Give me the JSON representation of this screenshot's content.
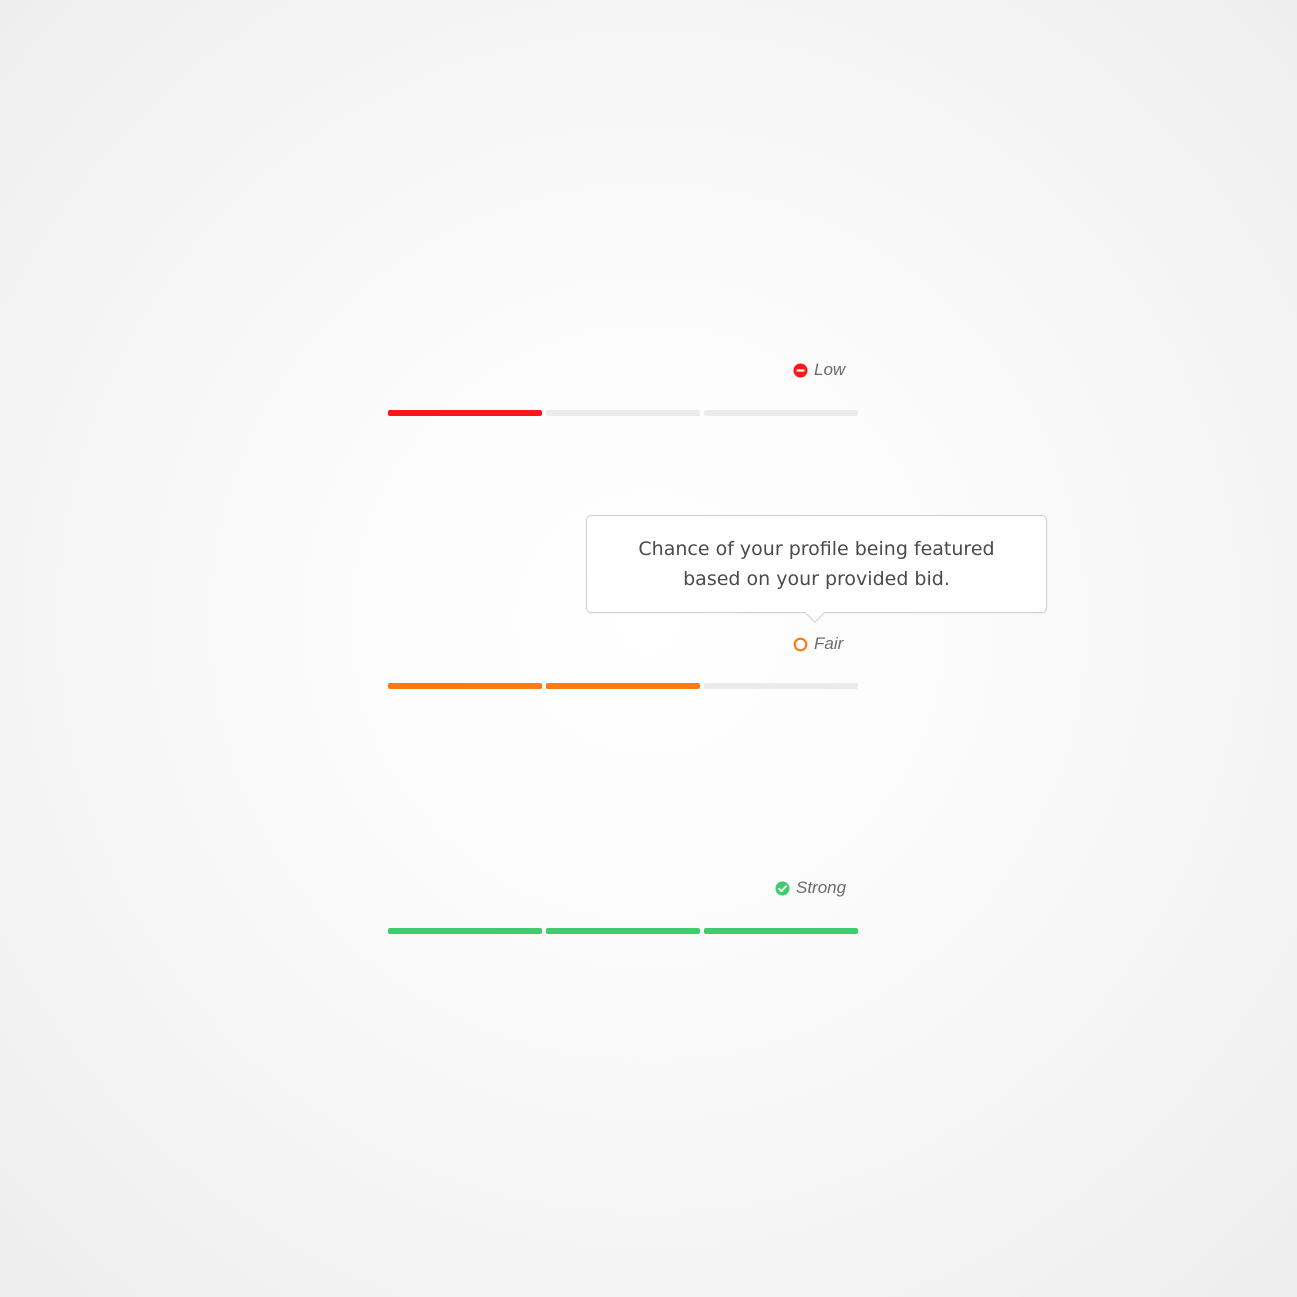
{
  "colors": {
    "low": "#ff1717",
    "fair": "#ff7a12",
    "strong": "#3ecd6e",
    "empty": "#ebebeb",
    "label_text": "#6b6b6b",
    "tooltip_text": "#4a4a4a"
  },
  "meters": [
    {
      "label": "Low",
      "icon": "minus-circle-icon",
      "filled_segments": 1,
      "total_segments": 3,
      "color": "#ff1717"
    },
    {
      "label": "Fair",
      "icon": "ring-circle-icon",
      "filled_segments": 2,
      "total_segments": 3,
      "color": "#ff7a12"
    },
    {
      "label": "Strong",
      "icon": "check-circle-icon",
      "filled_segments": 3,
      "total_segments": 3,
      "color": "#3ecd6e"
    }
  ],
  "tooltip": {
    "text": "Chance of your profile being featured based on your provided bid."
  }
}
